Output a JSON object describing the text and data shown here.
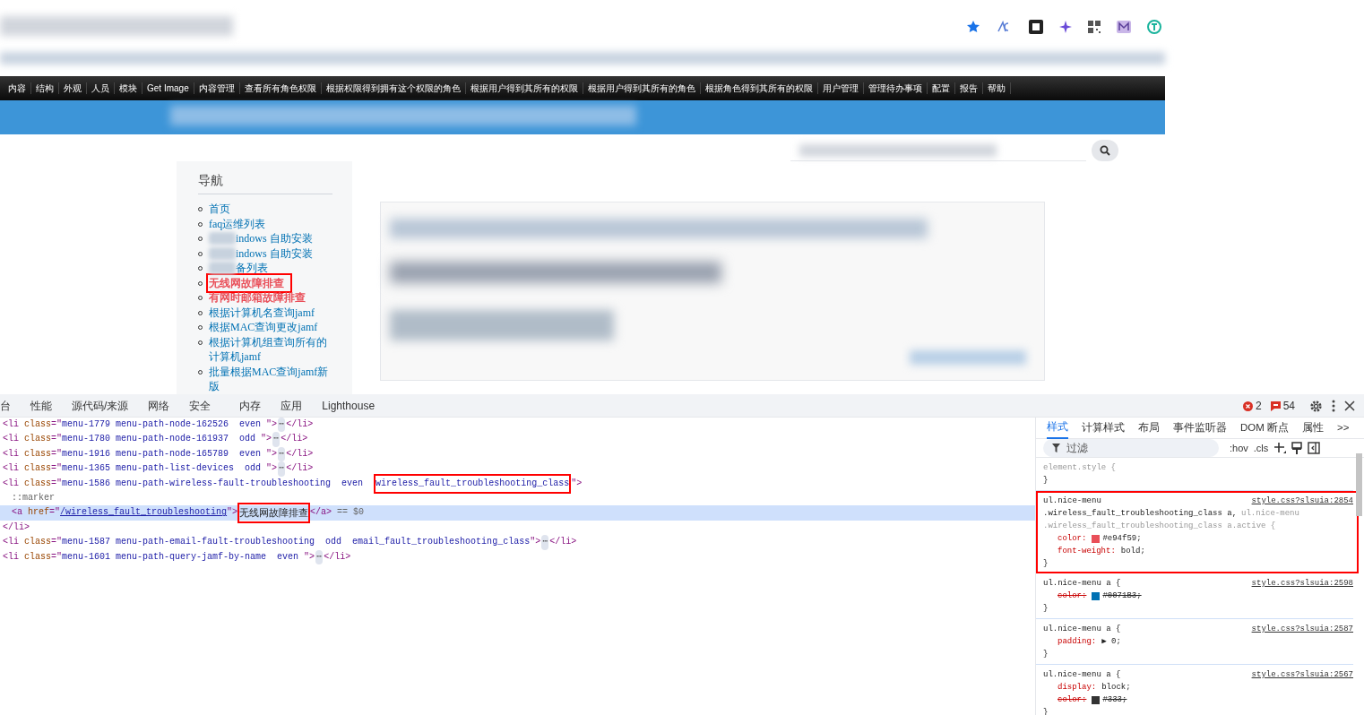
{
  "menu_bar": {
    "items": [
      "内容",
      "结构",
      "外观",
      "人员",
      "模块",
      "Get Image",
      "内容管理",
      "查看所有角色权限",
      "根据权限得到拥有这个权限的角色",
      "根据用户得到其所有的权限",
      "根据用户得到其所有的角色",
      "根据角色得到其所有的权限",
      "用户管理",
      "管理待办事项",
      "配置",
      "报告",
      "帮助"
    ]
  },
  "sidebar": {
    "title": "导航",
    "items": [
      {
        "label": "首页",
        "active": false,
        "blurred_prefix": false,
        "annotated": false
      },
      {
        "label": "faq运维列表",
        "active": false,
        "blurred_prefix": false,
        "annotated": false
      },
      {
        "label": "indows 自助安装",
        "active": false,
        "blurred_prefix": true,
        "annotated": false
      },
      {
        "label": "indows 自助安装",
        "active": false,
        "blurred_prefix": true,
        "annotated": false
      },
      {
        "label": "备列表",
        "active": false,
        "blurred_prefix": true,
        "annotated": false
      },
      {
        "label": "无线网故障排查",
        "active": true,
        "blurred_prefix": false,
        "annotated": true
      },
      {
        "label": "有网时邮箱故障排查",
        "active": true,
        "blurred_prefix": false,
        "annotated": false
      },
      {
        "label": "根据计算机名查询jamf",
        "active": false,
        "blurred_prefix": false,
        "annotated": false
      },
      {
        "label": "根据MAC查询更改jamf",
        "active": false,
        "blurred_prefix": false,
        "annotated": false
      },
      {
        "label": "根据计算机组查询所有的计算机jamf",
        "active": false,
        "blurred_prefix": false,
        "annotated": false
      },
      {
        "label": "批量根据MAC查询jamf新版",
        "active": false,
        "blurred_prefix": false,
        "annotated": false
      }
    ]
  },
  "devtools": {
    "tabs": [
      {
        "label": "台",
        "selected": false
      },
      {
        "label": "性能",
        "selected": false
      },
      {
        "label": "源代码/来源",
        "selected": false
      },
      {
        "label": "网络",
        "selected": false
      },
      {
        "label": "安全",
        "selected": false
      },
      {
        "label": "内存",
        "selected": false
      },
      {
        "label": "应用",
        "selected": false
      },
      {
        "label": "Lighthouse",
        "selected": false
      }
    ],
    "errors": "2",
    "issues": "54",
    "elements": [
      {
        "selected": false,
        "segments": [
          {
            "kind": "tag",
            "text": "<li "
          },
          {
            "kind": "attr",
            "text": "class"
          },
          {
            "kind": "tag",
            "text": "=\""
          },
          {
            "kind": "value",
            "text": "menu-1779 menu-path-node-162526  even "
          },
          {
            "kind": "tag",
            "text": "\">"
          },
          {
            "kind": "ellipsis",
            "text": "⋯"
          },
          {
            "kind": "tag",
            "text": "</li>"
          }
        ]
      },
      {
        "selected": false,
        "segments": [
          {
            "kind": "tag",
            "text": "<li "
          },
          {
            "kind": "attr",
            "text": "class"
          },
          {
            "kind": "tag",
            "text": "=\""
          },
          {
            "kind": "value",
            "text": "menu-1780 menu-path-node-161937  odd "
          },
          {
            "kind": "tag",
            "text": "\">"
          },
          {
            "kind": "ellipsis",
            "text": "⋯"
          },
          {
            "kind": "tag",
            "text": "</li>"
          }
        ]
      },
      {
        "selected": false,
        "segments": [
          {
            "kind": "tag",
            "text": "<li "
          },
          {
            "kind": "attr",
            "text": "class"
          },
          {
            "kind": "tag",
            "text": "=\""
          },
          {
            "kind": "value",
            "text": "menu-1916 menu-path-node-165789  even "
          },
          {
            "kind": "tag",
            "text": "\">"
          },
          {
            "kind": "ellipsis",
            "text": "⋯"
          },
          {
            "kind": "tag",
            "text": "</li>"
          }
        ]
      },
      {
        "selected": false,
        "segments": [
          {
            "kind": "tag",
            "text": "<li "
          },
          {
            "kind": "attr",
            "text": "class"
          },
          {
            "kind": "tag",
            "text": "=\""
          },
          {
            "kind": "value",
            "text": "menu-1365 menu-path-list-devices  odd "
          },
          {
            "kind": "tag",
            "text": "\">"
          },
          {
            "kind": "ellipsis",
            "text": "⋯"
          },
          {
            "kind": "tag",
            "text": "</li>"
          }
        ]
      },
      {
        "selected": false,
        "segments": [
          {
            "kind": "tag",
            "text": "<li "
          },
          {
            "kind": "attr",
            "text": "class"
          },
          {
            "kind": "tag",
            "text": "=\""
          },
          {
            "kind": "value",
            "text": "menu-1586 menu-path-wireless-fault-troubleshooting  even  "
          },
          {
            "kind": "value",
            "text": "wireless_fault_troubleshooting_class",
            "annotated": true
          },
          {
            "kind": "tag",
            "text": "\">"
          }
        ],
        "children": [
          {
            "selected": false,
            "segments": [
              {
                "kind": "pseudo",
                "text": "::marker"
              }
            ]
          },
          {
            "selected": true,
            "segments": [
              {
                "kind": "tag",
                "text": "<a "
              },
              {
                "kind": "attr",
                "text": "href"
              },
              {
                "kind": "tag",
                "text": "=\""
              },
              {
                "kind": "link",
                "text": "/wireless_fault_troubleshooting"
              },
              {
                "kind": "tag",
                "text": "\">"
              },
              {
                "kind": "text",
                "text": "无线网故障排查",
                "annotated": true
              },
              {
                "kind": "tag",
                "text": "</a>"
              },
              {
                "kind": "pseudo",
                "text": " == $0"
              }
            ]
          }
        ]
      },
      {
        "selected": false,
        "segments": [
          {
            "kind": "tag",
            "text": "</li>"
          }
        ]
      },
      {
        "selected": false,
        "segments": [
          {
            "kind": "tag",
            "text": "<li "
          },
          {
            "kind": "attr",
            "text": "class"
          },
          {
            "kind": "tag",
            "text": "=\""
          },
          {
            "kind": "value",
            "text": "menu-1587 menu-path-email-fault-troubleshooting  odd  email_fault_troubleshooting_class"
          },
          {
            "kind": "tag",
            "text": "\">"
          },
          {
            "kind": "ellipsis",
            "text": "⋯"
          },
          {
            "kind": "tag",
            "text": "</li>"
          }
        ]
      },
      {
        "selected": false,
        "segments": [
          {
            "kind": "tag",
            "text": "<li "
          },
          {
            "kind": "attr",
            "text": "class"
          },
          {
            "kind": "tag",
            "text": "=\""
          },
          {
            "kind": "value",
            "text": "menu-1601 menu-path-query-jamf-by-name  even "
          },
          {
            "kind": "tag",
            "text": "\">"
          },
          {
            "kind": "ellipsis",
            "text": "⋯"
          },
          {
            "kind": "tag",
            "text": "</li>"
          }
        ]
      }
    ],
    "side_tabs": [
      {
        "label": "样式",
        "selected": true
      },
      {
        "label": "计算样式",
        "selected": false
      },
      {
        "label": "布局",
        "selected": false
      },
      {
        "label": "事件监听器",
        "selected": false
      },
      {
        "label": "DOM 断点",
        "selected": false
      },
      {
        "label": "属性",
        "selected": false
      },
      {
        "label": ">>",
        "selected": false
      }
    ],
    "filter": {
      "placeholder": "过滤"
    },
    "hov": ":hov",
    "cls": ".cls",
    "rules": [
      {
        "annotated": false,
        "selector": [
          {
            "text": "element.style {",
            "matched": false
          }
        ],
        "close": "}"
      },
      {
        "annotated": true,
        "source": "style.css?slsuia:2854",
        "selector": [
          {
            "text": "ul.nice-menu",
            "matched": true
          },
          {
            "text": ".wireless_fault_troubleshooting_class a,",
            "matched": true
          },
          {
            "text": "ul.nice-menu",
            "matched": false
          },
          {
            "text": ".wireless_fault_troubleshooting_class a.active {",
            "matched": false
          }
        ],
        "properties": [
          {
            "name": "color:",
            "value": "#e94f59;",
            "color": "#e94f59",
            "struck": false
          },
          {
            "name": "font-weight:",
            "value": "bold;",
            "struck": false
          }
        ],
        "close": "}"
      },
      {
        "annotated": false,
        "source": "style.css?slsuia:2598",
        "selector": [
          {
            "text": "ul.nice-menu a {",
            "matched": true
          }
        ],
        "properties": [
          {
            "name": "color:",
            "value": "#0071B3;",
            "color": "#0071b3",
            "struck": true
          }
        ],
        "close": "}"
      },
      {
        "annotated": false,
        "source": "style.css?slsuia:2587",
        "selector": [
          {
            "text": "ul.nice-menu a {",
            "matched": true
          }
        ],
        "properties": [
          {
            "name": "padding:",
            "value": "▶ 0;",
            "struck": false
          }
        ],
        "close": "}"
      },
      {
        "annotated": false,
        "source": "style.css?slsuia:2567",
        "selector": [
          {
            "text": "ul.nice-menu a {",
            "matched": true
          }
        ],
        "properties": [
          {
            "name": "display:",
            "value": "block;",
            "struck": false
          },
          {
            "name": "color:",
            "value": "#333;",
            "color": "#333333",
            "struck": true
          }
        ],
        "close": "}"
      }
    ]
  }
}
